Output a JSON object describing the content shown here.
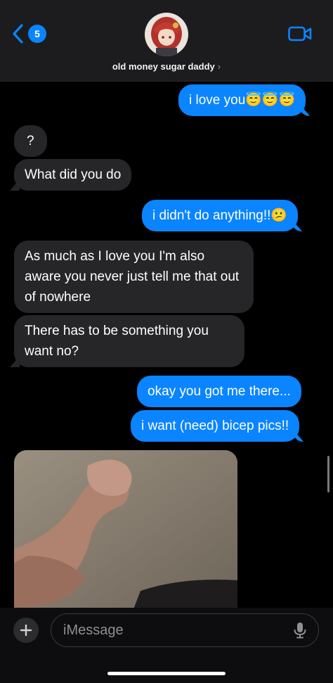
{
  "header": {
    "back_count": "5",
    "contact_name": "old money sugar daddy",
    "contact_chevron": "›",
    "back_icon": "chevron-left-icon",
    "call_icon": "video-camera-icon"
  },
  "messages": [
    {
      "dir": "out",
      "text": "i love you😇😇😇"
    },
    {
      "dir": "in",
      "text": "?"
    },
    {
      "dir": "in",
      "text": "What did you do"
    },
    {
      "dir": "out",
      "text": "i didn't do anything!!😕"
    },
    {
      "dir": "in",
      "text": "As much as I love you I'm also aware you never just tell me that out of nowhere"
    },
    {
      "dir": "in",
      "text": "There has to be something you want no?"
    },
    {
      "dir": "out",
      "text": "okay you got me there..."
    },
    {
      "dir": "out",
      "text": "i want (need) bicep pics!!"
    }
  ],
  "photo": {
    "description_icon": "photo-attachment"
  },
  "composer": {
    "placeholder": "iMessage",
    "plus_label": "+",
    "mic_icon": "microphone-icon"
  },
  "colors": {
    "accent": "#0a84ff",
    "incoming_bubble": "#262629",
    "background": "#000000"
  }
}
